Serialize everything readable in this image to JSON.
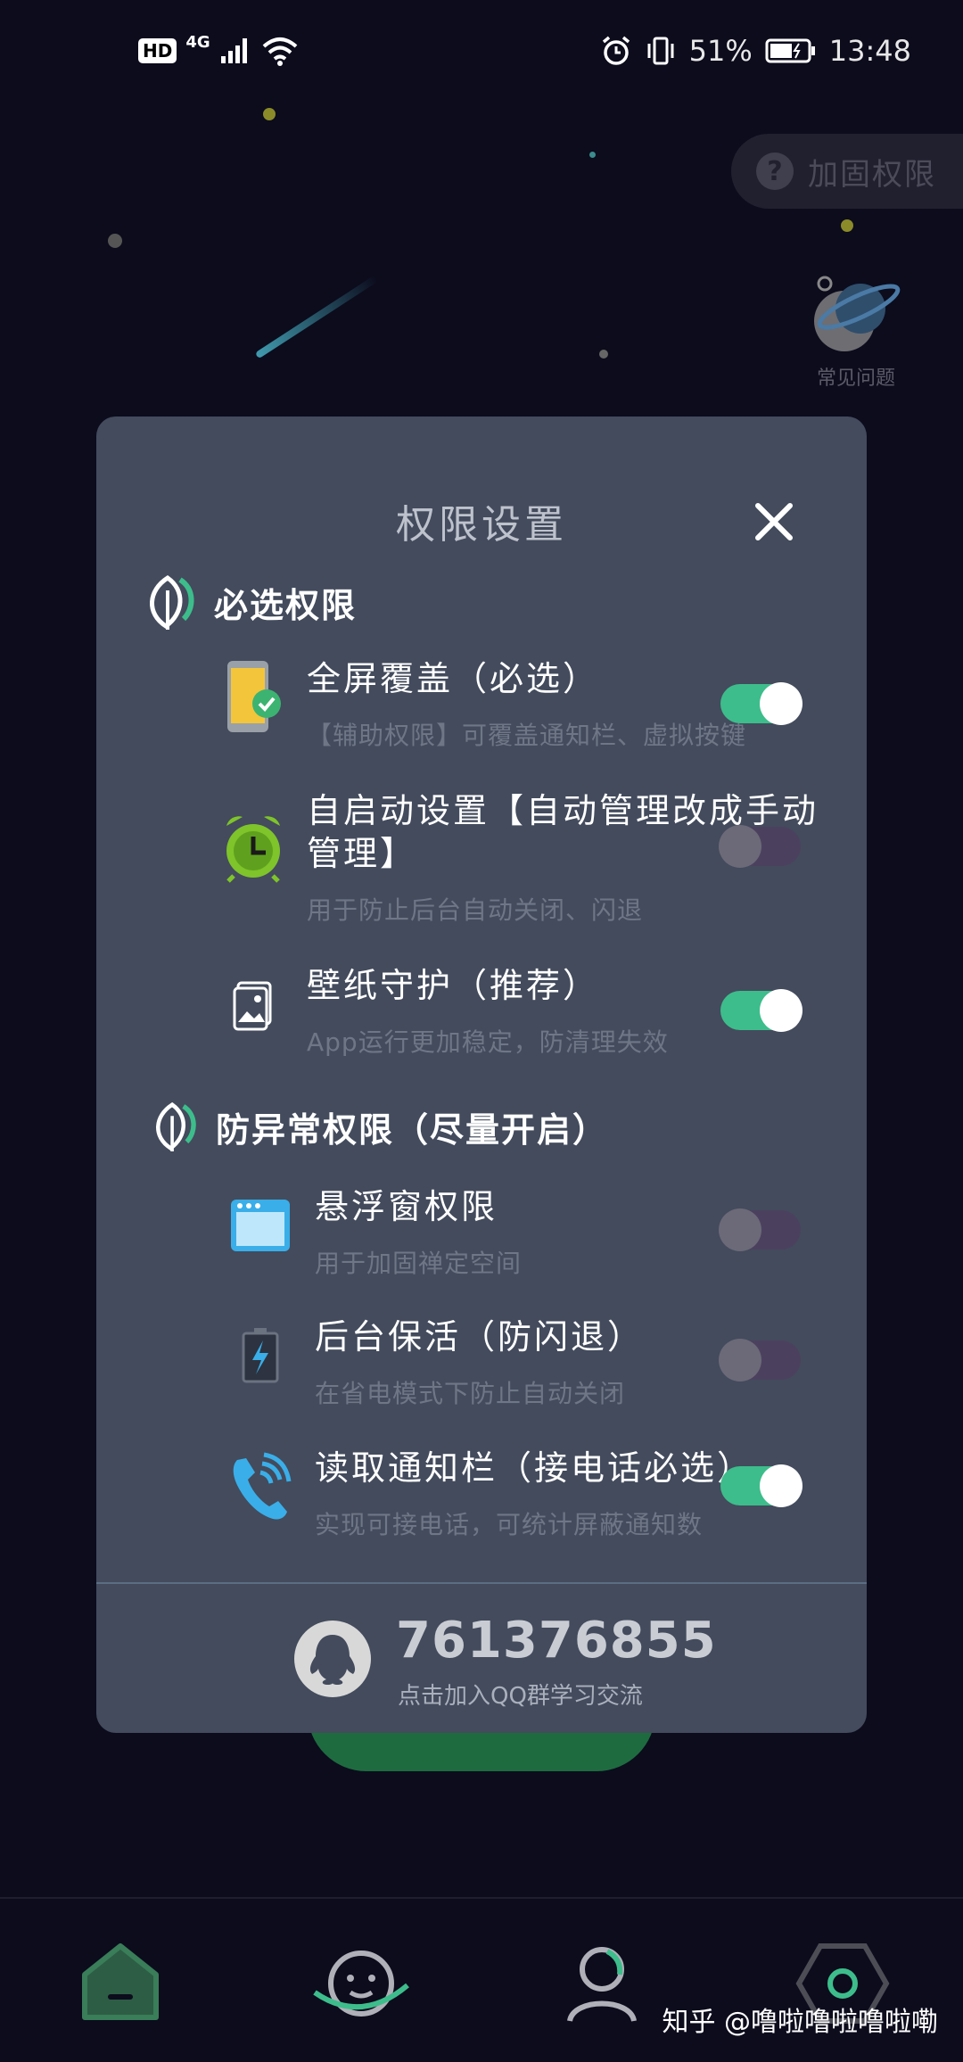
{
  "status_bar": {
    "hd_label": "HD",
    "network_label": "4G",
    "battery_percent": "51%",
    "time": "13:48"
  },
  "top_right": {
    "reinforce_label": "加固权限",
    "faq_label": "常见问题"
  },
  "modal": {
    "title": "权限设置",
    "required_section": {
      "title": "必选权限",
      "items": [
        {
          "title": "全屏覆盖（必选）",
          "subtitle": "【辅助权限】可覆盖通知栏、虚拟按键",
          "enabled": true,
          "icon": "phone-check-icon"
        },
        {
          "title_line1": "自启动设置【自动管理改成手动",
          "title_line2": "管理】",
          "subtitle": "用于防止后台自动关闭、闪退",
          "enabled": false,
          "icon": "alarm-clock-icon"
        },
        {
          "title": "壁纸守护（推荐）",
          "subtitle": "App运行更加稳定，防清理失效",
          "enabled": true,
          "icon": "wallpaper-icon"
        }
      ]
    },
    "optional_section": {
      "title": "防异常权限（尽量开启）",
      "items": [
        {
          "title": "悬浮窗权限",
          "subtitle": "用于加固禅定空间",
          "enabled": false,
          "icon": "floating-window-icon"
        },
        {
          "title": "后台保活（防闪退）",
          "subtitle": "在省电模式下防止自动关闭",
          "enabled": false,
          "icon": "battery-bolt-icon"
        },
        {
          "title": "读取通知栏（接电话必选）",
          "subtitle": "实现可接电话，可统计屏蔽通知数",
          "enabled": true,
          "icon": "phone-ringing-icon"
        }
      ]
    },
    "qq_group": {
      "number": "761376855",
      "label": "点击加入QQ群学习交流"
    }
  },
  "watermark": "知乎 @噜啦噜啦噜啦嘞",
  "colors": {
    "background": "#0c0c1d",
    "modal": "#434b5d",
    "toggle_on": "#3dbd8b",
    "toggle_off": "#4b415f",
    "accent_green": "#1e6b3f"
  }
}
